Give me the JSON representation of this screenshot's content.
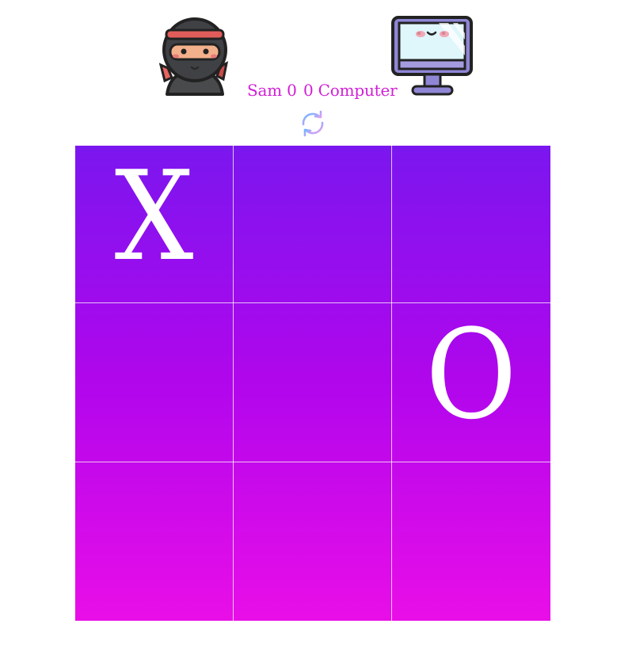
{
  "players": {
    "left": {
      "name": "Sam",
      "score": "0",
      "label": "Sam 0"
    },
    "right": {
      "name": "Computer",
      "score": "0",
      "label": "0 Computer"
    }
  },
  "reset_icon": "refresh-icon",
  "board": {
    "cells": [
      "X",
      "",
      "",
      "",
      "",
      "O",
      "",
      "",
      ""
    ]
  },
  "colors": {
    "score_text": "#d21fd6",
    "board_top": "#7b16ef",
    "board_middle": "#b106ec",
    "board_bottom": "#e90ee8",
    "mark": "#ffffff"
  }
}
